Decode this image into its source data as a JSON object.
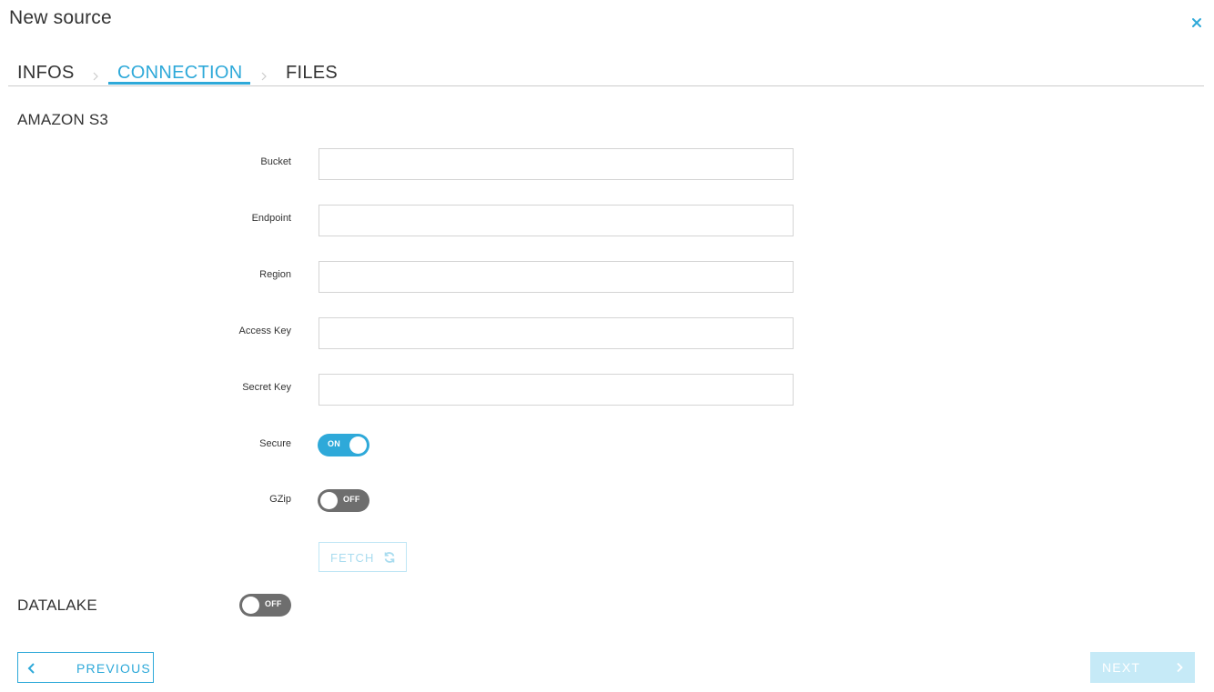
{
  "header": {
    "title": "New source",
    "close_icon": "close-icon"
  },
  "tabs": [
    {
      "label": "INFOS",
      "active": false
    },
    {
      "label": "CONNECTION",
      "active": true
    },
    {
      "label": "FILES",
      "active": false
    }
  ],
  "colors": {
    "accent": "#2ea9d9",
    "toggle_off": "#6e6e6e",
    "disabled_accent": "#c6eaf7"
  },
  "amazon_s3": {
    "title": "AMAZON S3",
    "fields": {
      "bucket": {
        "label": "Bucket",
        "value": ""
      },
      "endpoint": {
        "label": "Endpoint",
        "value": ""
      },
      "region": {
        "label": "Region",
        "value": ""
      },
      "access_key": {
        "label": "Access Key",
        "value": ""
      },
      "secret_key": {
        "label": "Secret Key",
        "value": ""
      }
    },
    "secure": {
      "label": "Secure",
      "state": "ON"
    },
    "gzip": {
      "label": "GZip",
      "state": "OFF"
    },
    "fetch": {
      "label": "FETCH",
      "icon": "refresh-icon"
    }
  },
  "datalake": {
    "title": "DATALAKE",
    "state": "OFF"
  },
  "footer": {
    "previous_label": "PREVIOUS",
    "next_label": "NEXT"
  }
}
